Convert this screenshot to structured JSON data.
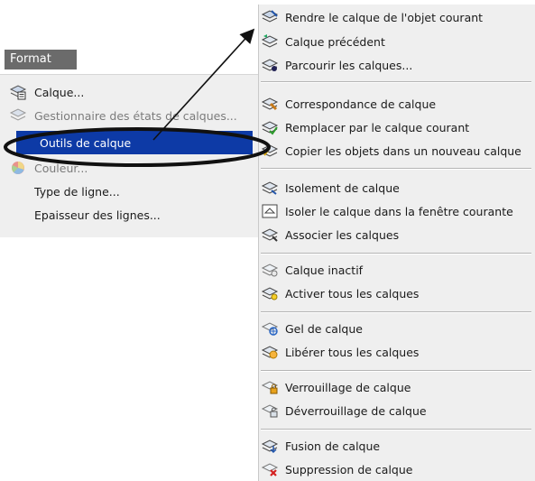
{
  "format_menu": {
    "title": "Format",
    "items": [
      {
        "label": "Calque..."
      },
      {
        "label": "Gestionnaire des états de calques..."
      },
      {
        "label": "Outils de calque"
      },
      {
        "label": "Couleur..."
      },
      {
        "label": "Type de ligne..."
      },
      {
        "label": "Epaisseur des lignes..."
      }
    ]
  },
  "submenu": {
    "items": [
      {
        "label": "Rendre le calque de l'objet courant",
        "icon": "make-current-layer-icon"
      },
      {
        "label": "Calque précédent",
        "icon": "previous-layer-icon"
      },
      {
        "label": "Parcourir les calques...",
        "icon": "walk-layers-icon"
      },
      {
        "label": "Correspondance de calque",
        "icon": "match-layer-icon"
      },
      {
        "label": "Remplacer par le calque courant",
        "icon": "change-to-current-layer-icon"
      },
      {
        "label": "Copier les objets dans un nouveau calque",
        "icon": "copy-objects-layer-icon"
      },
      {
        "label": "Isolement de calque",
        "icon": "layer-isolate-icon"
      },
      {
        "label": "Isoler le calque dans la fenêtre courante",
        "icon": "isolate-viewport-icon"
      },
      {
        "label": "Associer les calques",
        "icon": "merge-layers-icon"
      },
      {
        "label": "Calque inactif",
        "icon": "layer-off-icon"
      },
      {
        "label": "Activer tous les calques",
        "icon": "turn-all-layers-on-icon"
      },
      {
        "label": "Gel de calque",
        "icon": "layer-freeze-icon"
      },
      {
        "label": "Libérer tous les calques",
        "icon": "thaw-all-layers-icon"
      },
      {
        "label": "Verrouillage de calque",
        "icon": "layer-lock-icon"
      },
      {
        "label": "Déverrouillage de calque",
        "icon": "layer-unlock-icon"
      },
      {
        "label": "Fusion de calque",
        "icon": "layer-merge-icon"
      },
      {
        "label": "Suppression de calque",
        "icon": "layer-delete-icon"
      }
    ]
  },
  "colors": {
    "highlight": "#0d3aa6",
    "menu_bg": "#efefef",
    "title_bg": "#6b6b6b"
  }
}
